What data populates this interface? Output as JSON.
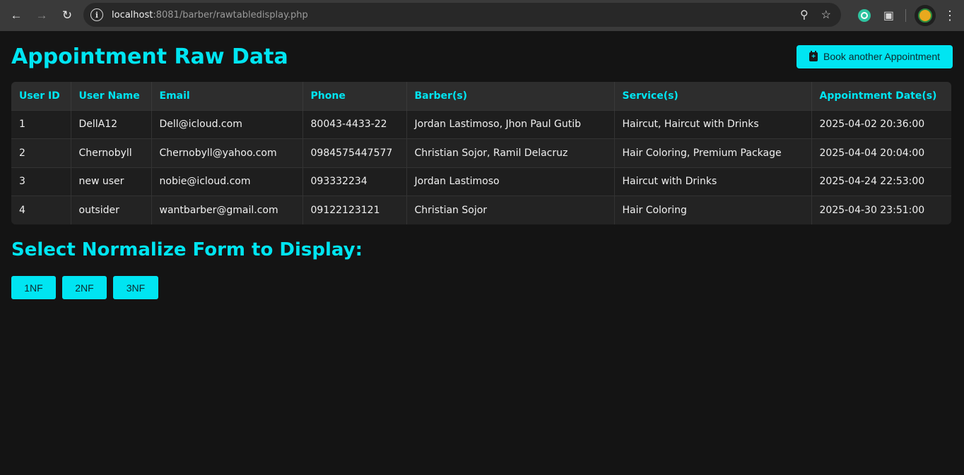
{
  "browser": {
    "url_host": "localhost",
    "url_rest": ":8081/barber/rawtabledisplay.php"
  },
  "page": {
    "title": "Appointment Raw Data",
    "book_button_label": "Book another Appointment",
    "section_title": "Select Normalize Form to Display:",
    "nf_buttons": [
      "1NF",
      "2NF",
      "3NF"
    ]
  },
  "table": {
    "headers": [
      "User ID",
      "User Name",
      "Email",
      "Phone",
      "Barber(s)",
      "Service(s)",
      "Appointment Date(s)"
    ],
    "rows": [
      [
        "1",
        "DellA12",
        "Dell@icloud.com",
        "80043-4433-22",
        "Jordan Lastimoso, Jhon Paul Gutib",
        "Haircut, Haircut with Drinks",
        "2025-04-02 20:36:00"
      ],
      [
        "2",
        "Chernobyll",
        "Chernobyll@yahoo.com",
        "0984575447577",
        "Christian Sojor, Ramil Delacruz",
        "Hair Coloring, Premium Package",
        "2025-04-04 20:04:00"
      ],
      [
        "3",
        "new user",
        "nobie@icloud.com",
        "093332234",
        "Jordan Lastimoso",
        "Haircut with Drinks",
        "2025-04-24 22:53:00"
      ],
      [
        "4",
        "outsider",
        "wantbarber@gmail.com",
        "09122123121",
        "Christian Sojor",
        "Hair Coloring",
        "2025-04-30 23:51:00"
      ]
    ]
  },
  "colors": {
    "accent": "#00e5f2",
    "background": "#141414"
  }
}
